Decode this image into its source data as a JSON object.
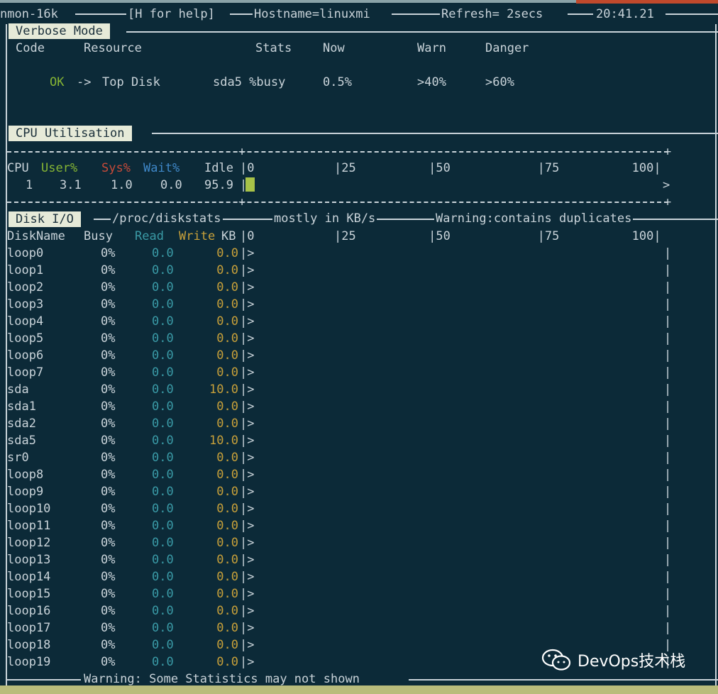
{
  "header": {
    "app": "nmon-16k",
    "help": "[H for help]",
    "hostname": "Hostname=linuxmi",
    "refresh": "Refresh= 2secs",
    "time": "20:41.21"
  },
  "verbose": {
    "tab": "Verbose Mode",
    "col_code": "Code",
    "col_resource": "Resource",
    "col_stats": "Stats",
    "col_now": "Now",
    "col_warn": "Warn",
    "col_danger": "Danger",
    "row": {
      "code": "OK",
      "arrow": "->",
      "resource": "Top Disk",
      "stats": "sda5 %busy",
      "now": "0.5%",
      "warn": ">40%",
      "danger": ">60%"
    }
  },
  "cpu": {
    "tab": "CPU Utilisation",
    "head_cpu": "CPU",
    "head_user": "User%",
    "head_sys": "Sys%",
    "head_wait": "Wait%",
    "head_idle": "Idle",
    "scale": "|0           |25          |50            |75          100|",
    "row": {
      "cpu": "1",
      "user": "3.1",
      "sys": "1.0",
      "wait": "0.0",
      "idle": "95.9"
    },
    "end_marker": ">"
  },
  "disk": {
    "tab": "Disk I/O",
    "title_source": "/proc/diskstats",
    "title_units": "mostly in KB/s",
    "title_warning": "Warning:contains duplicates",
    "head_name": "DiskName",
    "head_busy": "Busy",
    "head_read": "Read",
    "head_write": "Write",
    "head_kb": "KB",
    "scale": "|0           |25          |50            |75          100|",
    "rows": [
      {
        "name": "loop0",
        "busy": "0%",
        "read": "0.0",
        "write": "0.0"
      },
      {
        "name": "loop1",
        "busy": "0%",
        "read": "0.0",
        "write": "0.0"
      },
      {
        "name": "loop2",
        "busy": "0%",
        "read": "0.0",
        "write": "0.0"
      },
      {
        "name": "loop3",
        "busy": "0%",
        "read": "0.0",
        "write": "0.0"
      },
      {
        "name": "loop4",
        "busy": "0%",
        "read": "0.0",
        "write": "0.0"
      },
      {
        "name": "loop5",
        "busy": "0%",
        "read": "0.0",
        "write": "0.0"
      },
      {
        "name": "loop6",
        "busy": "0%",
        "read": "0.0",
        "write": "0.0"
      },
      {
        "name": "loop7",
        "busy": "0%",
        "read": "0.0",
        "write": "0.0"
      },
      {
        "name": "sda",
        "busy": "0%",
        "read": "0.0",
        "write": "10.0"
      },
      {
        "name": "sda1",
        "busy": "0%",
        "read": "0.0",
        "write": "0.0"
      },
      {
        "name": "sda2",
        "busy": "0%",
        "read": "0.0",
        "write": "0.0"
      },
      {
        "name": "sda5",
        "busy": "0%",
        "read": "0.0",
        "write": "10.0"
      },
      {
        "name": "sr0",
        "busy": "0%",
        "read": "0.0",
        "write": "0.0"
      },
      {
        "name": "loop8",
        "busy": "0%",
        "read": "0.0",
        "write": "0.0"
      },
      {
        "name": "loop9",
        "busy": "0%",
        "read": "0.0",
        "write": "0.0"
      },
      {
        "name": "loop10",
        "busy": "0%",
        "read": "0.0",
        "write": "0.0"
      },
      {
        "name": "loop11",
        "busy": "0%",
        "read": "0.0",
        "write": "0.0"
      },
      {
        "name": "loop12",
        "busy": "0%",
        "read": "0.0",
        "write": "0.0"
      },
      {
        "name": "loop13",
        "busy": "0%",
        "read": "0.0",
        "write": "0.0"
      },
      {
        "name": "loop14",
        "busy": "0%",
        "read": "0.0",
        "write": "0.0"
      },
      {
        "name": "loop15",
        "busy": "0%",
        "read": "0.0",
        "write": "0.0"
      },
      {
        "name": "loop16",
        "busy": "0%",
        "read": "0.0",
        "write": "0.0"
      },
      {
        "name": "loop17",
        "busy": "0%",
        "read": "0.0",
        "write": "0.0"
      },
      {
        "name": "loop18",
        "busy": "0%",
        "read": "0.0",
        "write": "0.0"
      },
      {
        "name": "loop19",
        "busy": "0%",
        "read": "0.0",
        "write": "0.0"
      }
    ],
    "bar_marker": "|>",
    "footer_warning": "Warning: Some Statistics may not shown"
  },
  "watermark": {
    "icon": "wechat-icon",
    "text": "DevOps技术栈"
  },
  "colors": {
    "background": "#0c2a38",
    "ok": "#86b534",
    "user": "#86b534",
    "sys": "#c74a39",
    "wait": "#3f88c9",
    "read": "#3a9aa6",
    "write": "#c7a03a"
  }
}
